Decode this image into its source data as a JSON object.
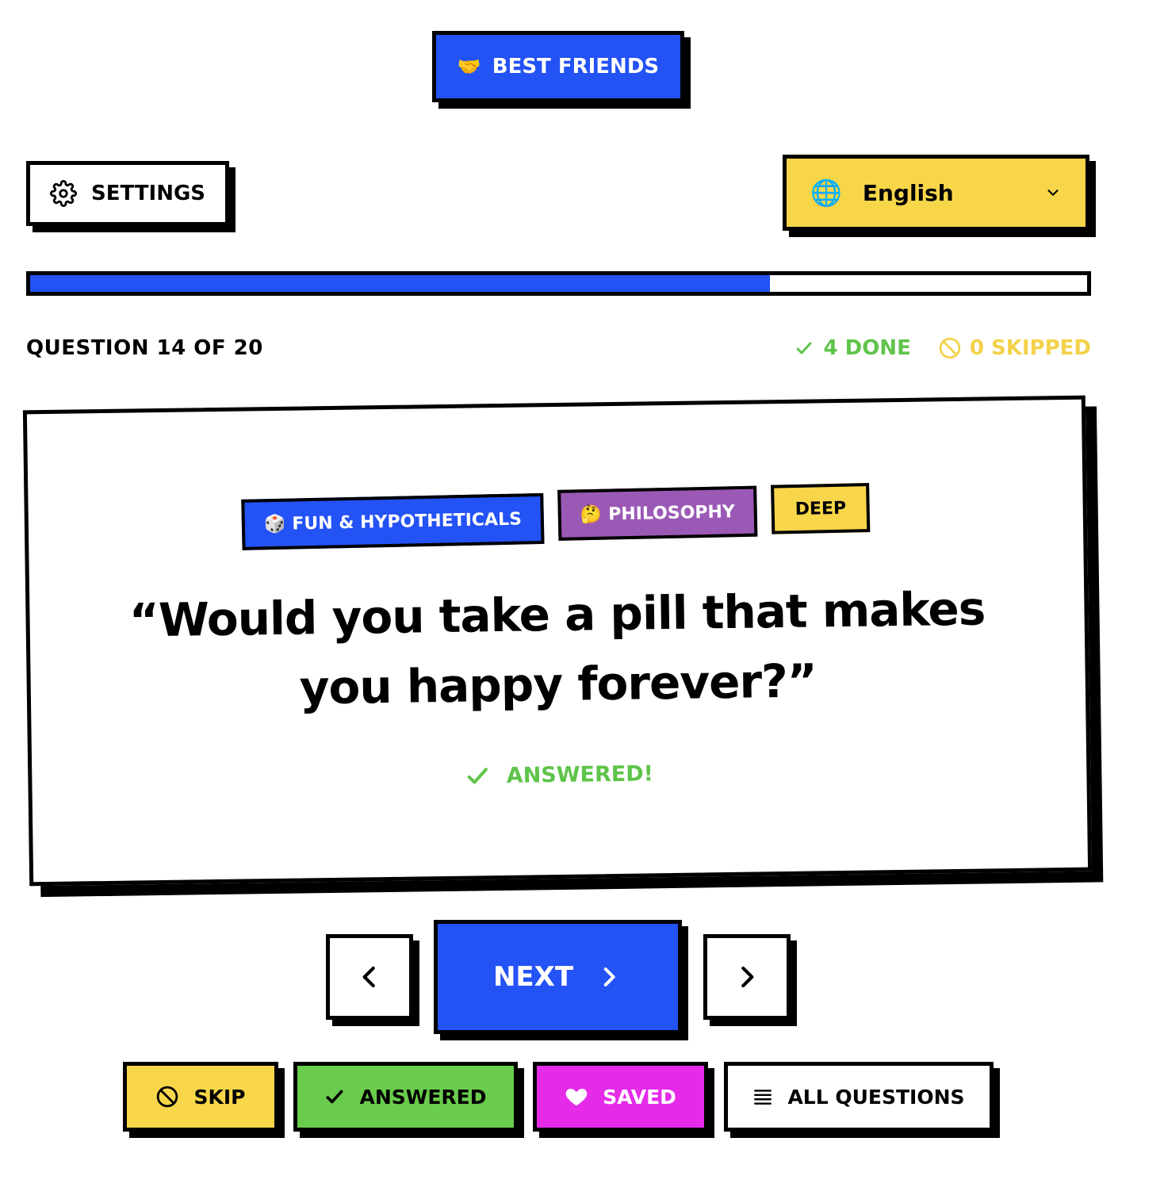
{
  "mode_badge": {
    "emoji": "🤝",
    "label": "BEST FRIENDS"
  },
  "settings": {
    "label": "SETTINGS"
  },
  "language": {
    "globe": "🌐",
    "selected": "English"
  },
  "progress": {
    "current": 14,
    "total": 20,
    "fraction": 0.7
  },
  "status": {
    "counter": "QUESTION 14 OF 20",
    "done": "4 DONE",
    "skipped": "0 SKIPPED"
  },
  "card": {
    "tags": [
      {
        "emoji": "🎲",
        "label": "FUN & HYPOTHETICALS"
      },
      {
        "emoji": "🤔",
        "label": "PHILOSOPHY"
      },
      {
        "emoji": "",
        "label": "DEEP"
      }
    ],
    "question": "“Would you take a pill that makes you happy forever?”",
    "answered_label": "ANSWERED!"
  },
  "nav": {
    "next_label": "NEXT"
  },
  "actions": {
    "skip": "SKIP",
    "answered": "ANSWERED",
    "saved": "SAVED",
    "all_questions": "ALL QUESTIONS"
  },
  "colors": {
    "blue": "#2352f5",
    "yellow": "#f7d64a",
    "green": "#6acc4c",
    "magenta": "#e52be8",
    "purple": "#9b59b6"
  }
}
